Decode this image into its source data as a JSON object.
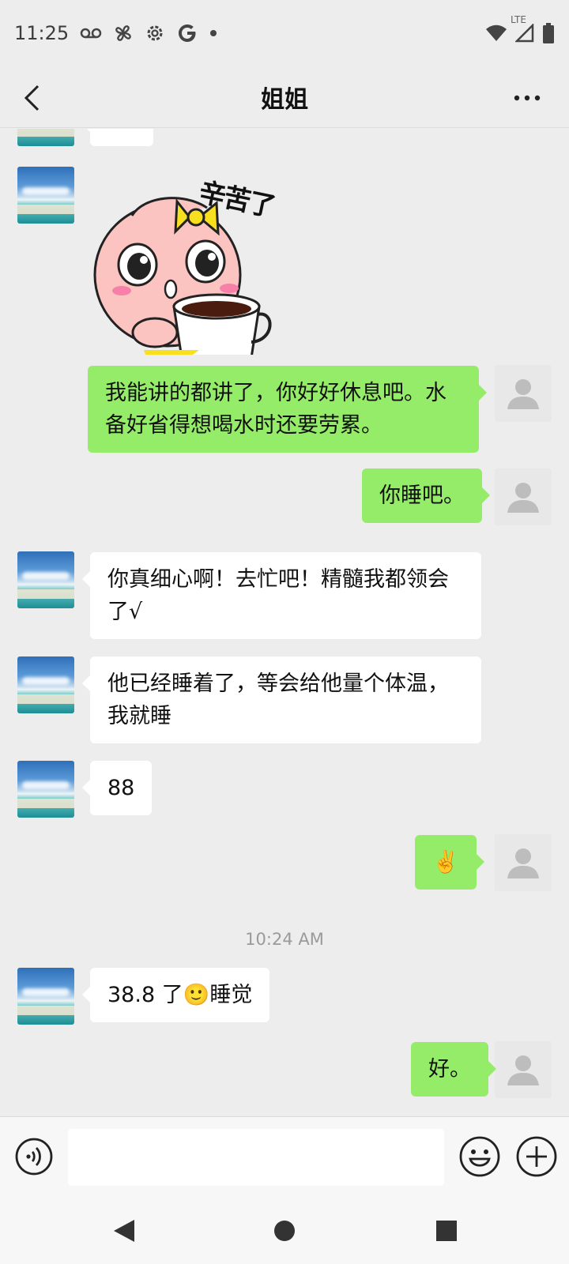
{
  "status_bar": {
    "time": "11:25",
    "network_label": "LTE",
    "icons": [
      "voicemail-icon",
      "fan-icon",
      "settings-icon",
      "google-icon",
      "dot-icon",
      "wifi-icon",
      "signal-icon",
      "battery-icon"
    ]
  },
  "header": {
    "title": "姐姐"
  },
  "messages": [
    {
      "side": "in",
      "type": "sticker-partial"
    },
    {
      "side": "in",
      "type": "sticker",
      "sticker_text": "辛苦了"
    },
    {
      "side": "out",
      "type": "text",
      "text": "我能讲的都讲了，你好好休息吧。水备好省得想喝水时还要劳累。"
    },
    {
      "side": "out",
      "type": "text",
      "text": "你睡吧。"
    },
    {
      "side": "in",
      "type": "text",
      "text": "你真细心啊！去忙吧！精髓我都领会了√"
    },
    {
      "side": "in",
      "type": "text",
      "text": "他已经睡着了，等会给他量个体温，我就睡"
    },
    {
      "side": "in",
      "type": "text",
      "text": "88"
    },
    {
      "side": "out",
      "type": "emoji",
      "text": "✌️"
    },
    {
      "side": "in",
      "type": "text",
      "text": "38.8 了🙂睡觉"
    },
    {
      "side": "out",
      "type": "text",
      "text": "好。"
    }
  ],
  "timestamp": "10:24 AM",
  "input_bar": {
    "placeholder": ""
  },
  "colors": {
    "background": "#ededed",
    "out_bubble": "#95ec69",
    "in_bubble": "#ffffff",
    "timestamp": "#9a9a9a"
  }
}
